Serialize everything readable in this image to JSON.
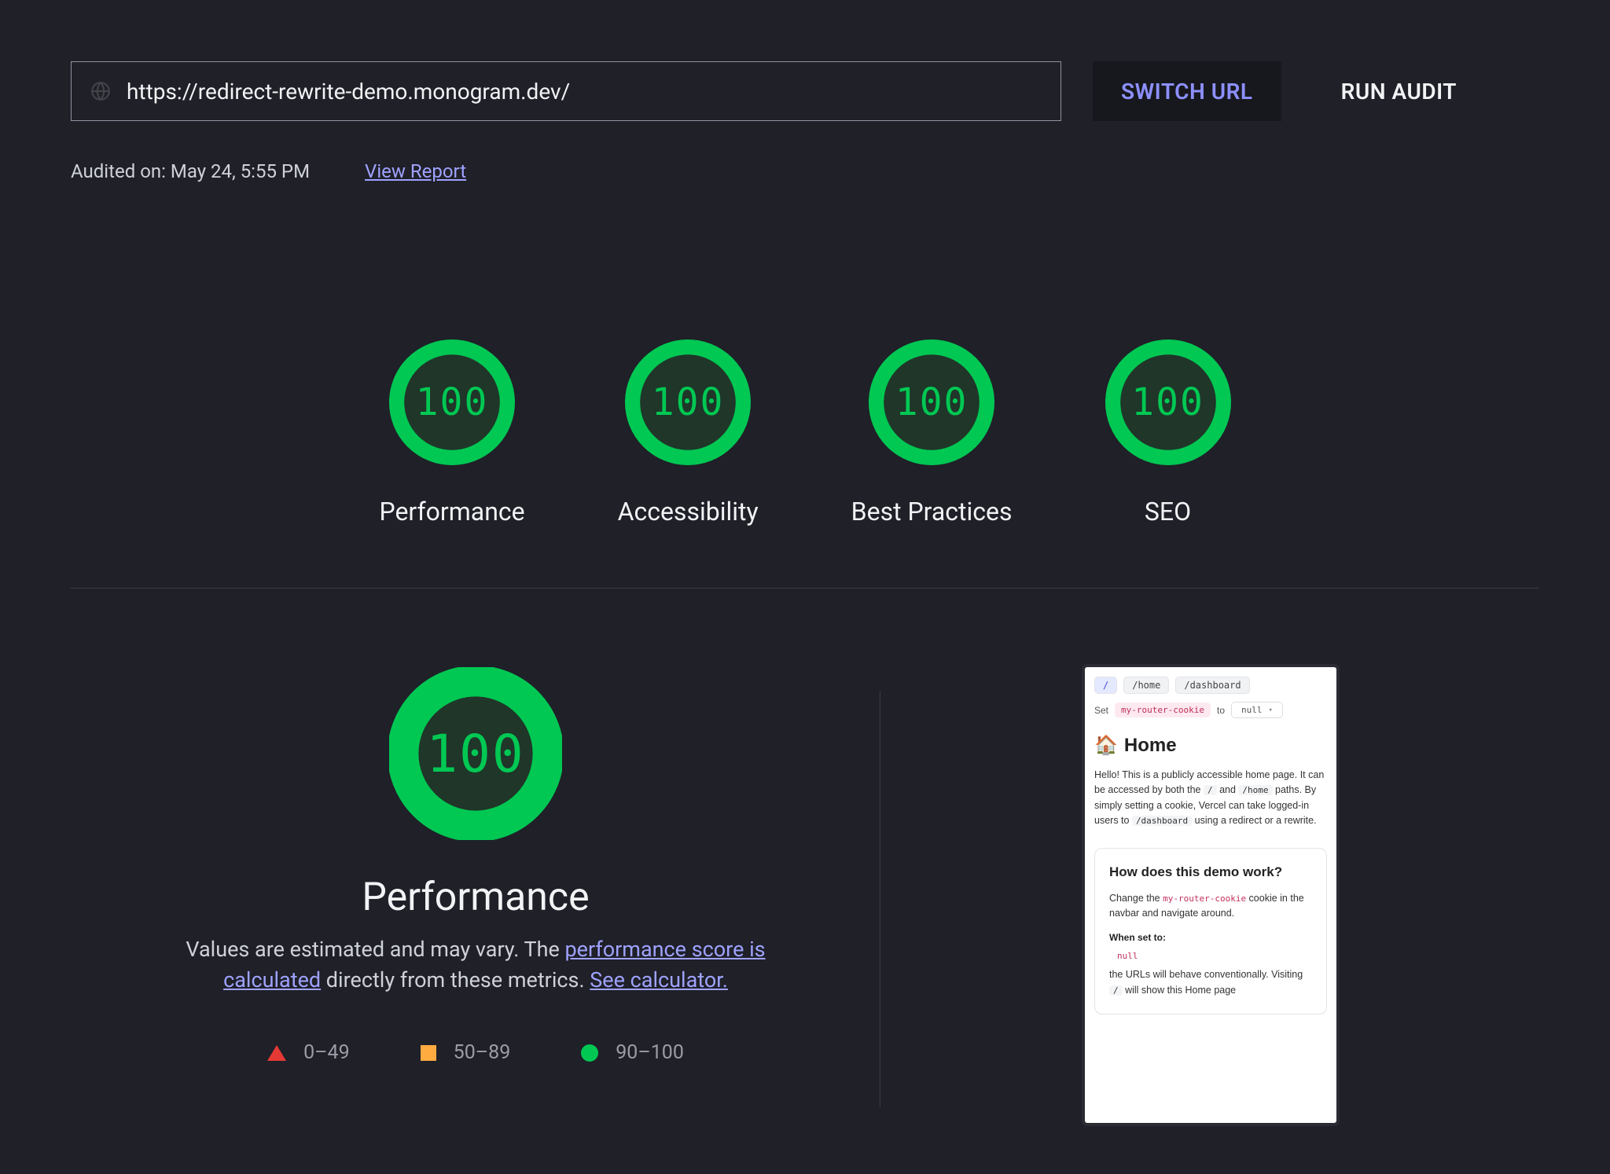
{
  "url": "https://redirect-rewrite-demo.monogram.dev/",
  "buttons": {
    "switch": "SWITCH URL",
    "audit": "RUN AUDIT"
  },
  "meta": {
    "audited_on": "Audited on: May 24, 5:55 PM",
    "view_report": "View Report"
  },
  "scores": {
    "performance": {
      "value": "100",
      "label": "Performance"
    },
    "accessibility": {
      "value": "100",
      "label": "Accessibility"
    },
    "best_practices": {
      "value": "100",
      "label": "Best Practices"
    },
    "seo": {
      "value": "100",
      "label": "SEO"
    }
  },
  "detail": {
    "value": "100",
    "title": "Performance",
    "desc1": "Values are estimated and may vary. The ",
    "link1": "performance score is calculated",
    "desc2": " directly from these metrics. ",
    "link2": "See calculator."
  },
  "legend": {
    "r1": "0–49",
    "r2": "50–89",
    "r3": "90–100"
  },
  "preview": {
    "tabs": {
      "root": "/",
      "home": "/home",
      "dashboard": "/dashboard"
    },
    "set": "Set",
    "cookie": "my-router-cookie",
    "to": "to",
    "null": "null",
    "home_title": "Home",
    "p1a": "Hello! This is a publicly accessible home page. It can be accessed by both the ",
    "p1b": " and ",
    "p1c": " paths. By simply setting a cookie, Vercel can take logged-in users to ",
    "p1d": " using a redirect or a rewrite.",
    "card_title": "How does this demo work?",
    "card_p1a": "Change the ",
    "card_p1b": " cookie in the navbar and navigate around.",
    "when_set": "When set to:",
    "card_p2a": "the URLs will behave conventionally. Visiting ",
    "card_p2b": " will show this Home page"
  }
}
